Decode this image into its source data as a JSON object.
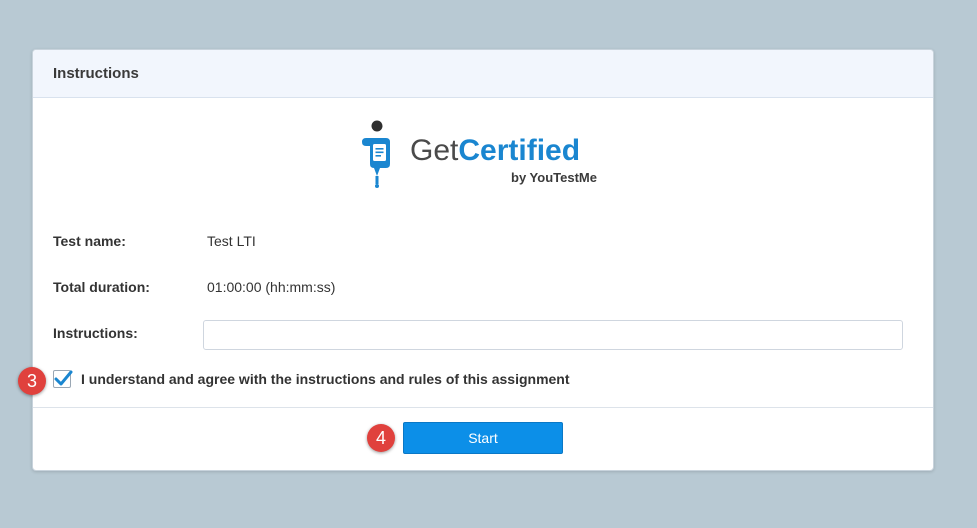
{
  "panel": {
    "title": "Instructions"
  },
  "logo": {
    "word_get": "Get",
    "word_certified": "Certified",
    "sub": "by YouTestMe",
    "brand_color": "#1a86d0"
  },
  "fields": {
    "test_name_label": "Test name:",
    "test_name_value": "Test LTI",
    "duration_label": "Total duration:",
    "duration_value": "01:00:00 (hh:mm:ss)",
    "instructions_label": "Instructions:",
    "instructions_value": ""
  },
  "agreement": {
    "text": "I understand and agree with the instructions and rules of this assignment",
    "checked": true
  },
  "actions": {
    "start_label": "Start",
    "accent": "#0c8fe8"
  },
  "annotations": {
    "badge_checkbox": "3",
    "badge_start": "4"
  }
}
